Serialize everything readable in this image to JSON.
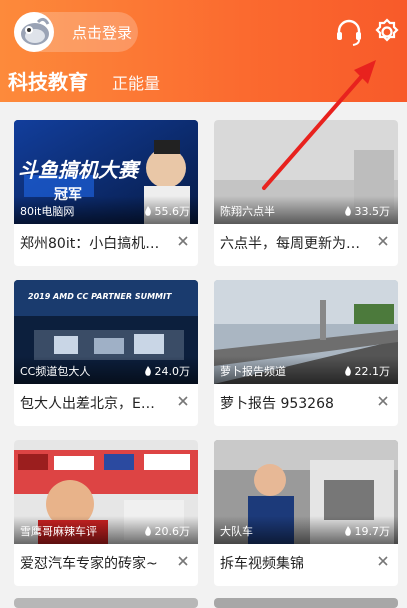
{
  "header": {
    "login_label": "点击登录",
    "tabs": [
      {
        "label": "科技教育",
        "active": true
      },
      {
        "label": "正能量",
        "active": false
      }
    ],
    "icons": [
      "headset-icon",
      "gear-icon"
    ]
  },
  "cards": [
    {
      "uploader": "80it电脑网",
      "views": "55.6万",
      "title": "郑州80it：小白搞机…",
      "thumb_caption": "斗鱼搞机大赛",
      "thumb_sub": "冠军"
    },
    {
      "uploader": "陈翔六点半",
      "views": "33.5万",
      "title": "六点半，每周更新为…",
      "thumb_caption": "",
      "thumb_sub": ""
    },
    {
      "uploader": "CC频道包大人",
      "views": "24.0万",
      "title": "包大人出差北京，E…",
      "thumb_caption": "2019 AMD CC PARTNER SUMMIT",
      "thumb_sub": ""
    },
    {
      "uploader": "萝卜报告频道",
      "views": "22.1万",
      "title": "萝卜报告 953268",
      "thumb_caption": "",
      "thumb_sub": ""
    },
    {
      "uploader": "雪鹰哥麻辣车评",
      "views": "20.6万",
      "title": "爱怼汽车专家的砖家~",
      "thumb_caption": "",
      "thumb_sub": ""
    },
    {
      "uploader": "大队车",
      "views": "19.7万",
      "title": "拆车视频集锦",
      "thumb_caption": "",
      "thumb_sub": ""
    }
  ],
  "colors": {
    "accent": "#fb6a2f",
    "annotation_arrow": "#e8221e"
  }
}
